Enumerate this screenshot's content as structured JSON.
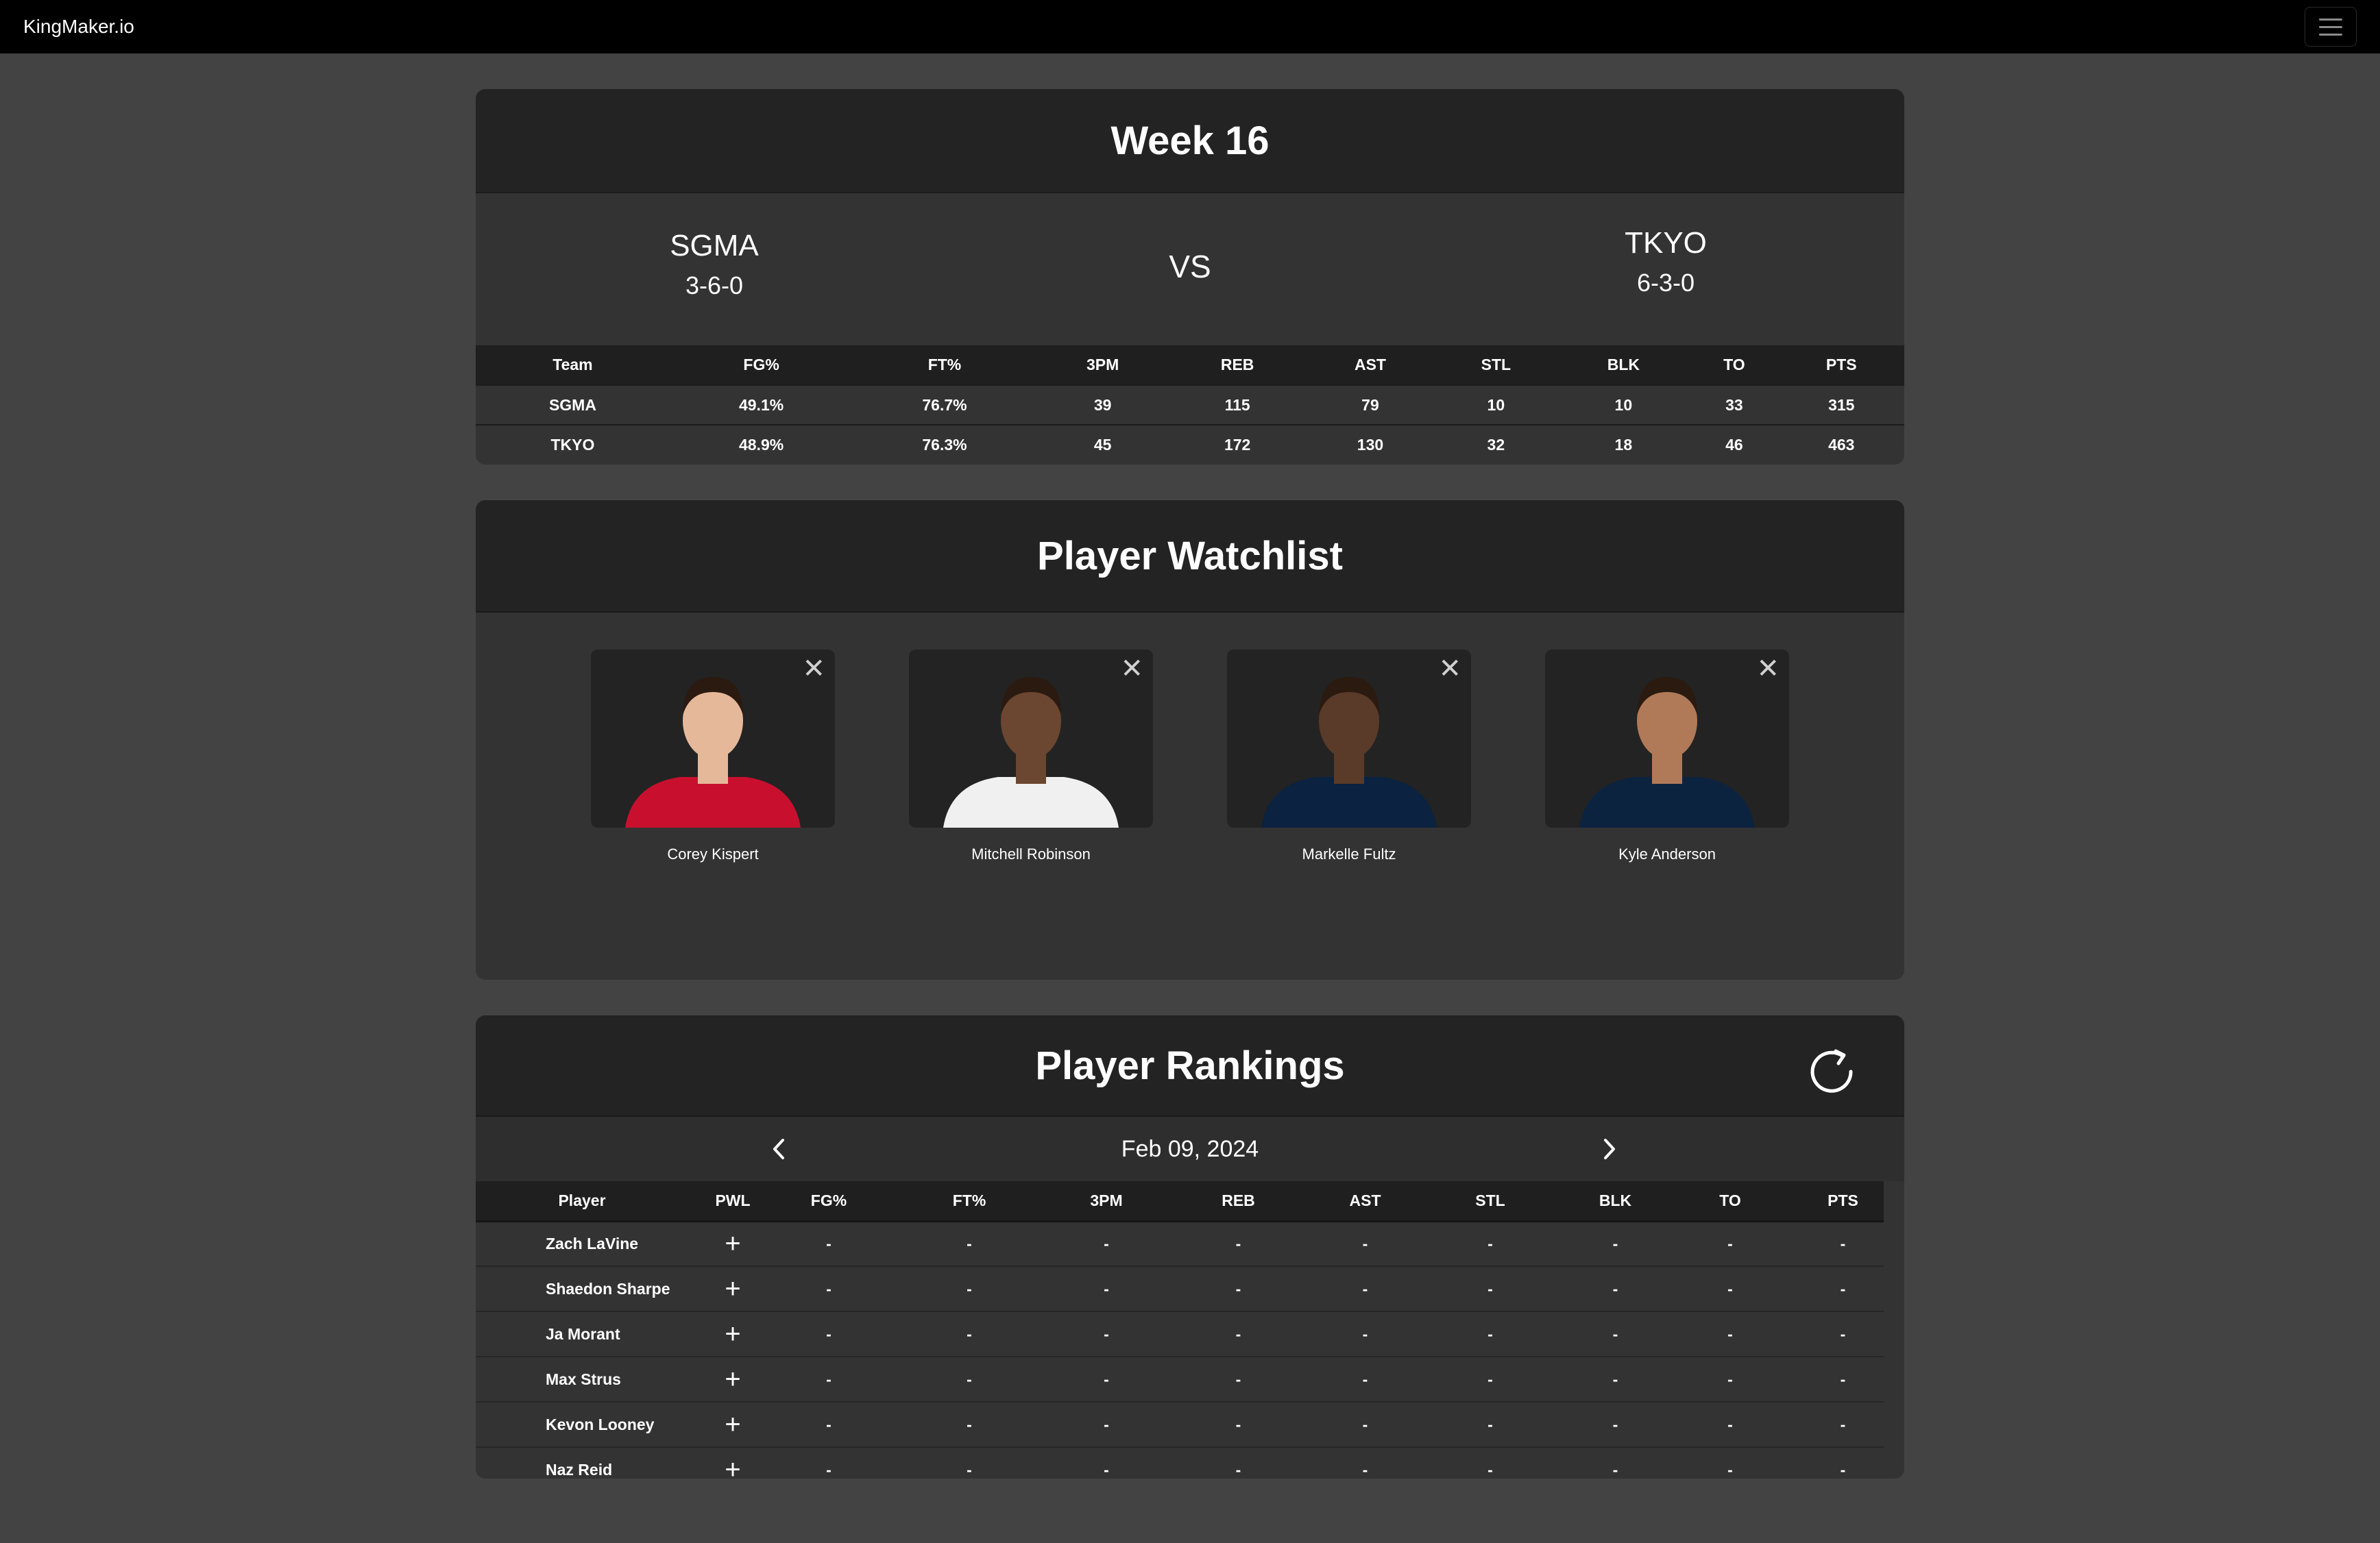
{
  "navbar": {
    "brand": "KingMaker.io",
    "menu_icon": "hamburger-icon"
  },
  "week": {
    "title": "Week 16",
    "vs_label": "VS",
    "home": {
      "name": "SGMA",
      "record": "3-6-0"
    },
    "away": {
      "name": "TKYO",
      "record": "6-3-0"
    },
    "columns": [
      "Team",
      "FG%",
      "FT%",
      "3PM",
      "REB",
      "AST",
      "STL",
      "BLK",
      "TO",
      "PTS"
    ],
    "rows": [
      [
        "SGMA",
        "49.1%",
        "76.7%",
        "39",
        "115",
        "79",
        "10",
        "10",
        "33",
        "315"
      ],
      [
        "TKYO",
        "48.9%",
        "76.3%",
        "45",
        "172",
        "130",
        "32",
        "18",
        "46",
        "463"
      ]
    ]
  },
  "watchlist": {
    "title": "Player Watchlist",
    "close_icon": "close-icon",
    "players": [
      {
        "name": "Corey Kispert",
        "jersey": "#c8102e"
      },
      {
        "name": "Mitchell Robinson",
        "jersey": "#f0f0f0"
      },
      {
        "name": "Markelle Fultz",
        "jersey": "#0b2240"
      },
      {
        "name": "Kyle Anderson",
        "jersey": "#0c2340"
      }
    ]
  },
  "rankings": {
    "title": "Player Rankings",
    "refresh_icon": "refresh-icon",
    "date": "Feb 09, 2024",
    "prev_icon": "chevron-left-icon",
    "next_icon": "chevron-right-icon",
    "columns": [
      "Player",
      "PWL",
      "FG%",
      "FT%",
      "3PM",
      "REB",
      "AST",
      "STL",
      "BLK",
      "TO",
      "PTS"
    ],
    "add_symbol": "+",
    "empty_value": "-",
    "players": [
      "Zach LaVine",
      "Shaedon Sharpe",
      "Ja Morant",
      "Max Strus",
      "Kevon Looney",
      "Naz Reid"
    ]
  },
  "colors": {
    "page_bg": "#434343",
    "card_bg": "#333333",
    "header_bg": "#232323",
    "navbar_bg": "#000000"
  }
}
